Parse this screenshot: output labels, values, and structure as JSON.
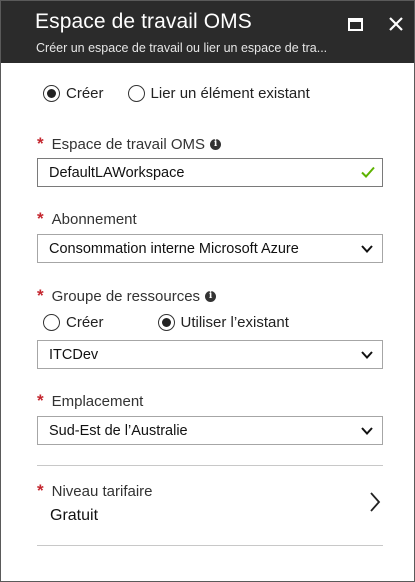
{
  "header": {
    "title": "Espace de travail OMS",
    "subtitle": "Créer un espace de travail ou lier un espace de tra..."
  },
  "mode": {
    "options": [
      "Créer",
      "Lier un élément existant"
    ],
    "selected": "Créer"
  },
  "workspace": {
    "label": "Espace de travail OMS",
    "value": "DefaultLAWorkspace",
    "valid": true
  },
  "subscription": {
    "label": "Abonnement",
    "value": "Consommation interne Microsoft Azure"
  },
  "resource_group": {
    "label": "Groupe de ressources",
    "options": [
      "Créer",
      "Utiliser l’existant"
    ],
    "selected": "Utiliser l’existant",
    "value": "ITCDev"
  },
  "location": {
    "label": "Emplacement",
    "value": "Sud-Est de l’Australie"
  },
  "pricing_tier": {
    "label": "Niveau tarifaire",
    "value": "Gratuit"
  },
  "colors": {
    "header_bg": "#2b2b2b",
    "required": "#c4262e",
    "valid_check": "#5db300"
  },
  "icons": [
    "maximize-icon",
    "close-icon",
    "info-icon",
    "checkmark-icon",
    "chevron-down-icon",
    "chevron-right-icon"
  ]
}
